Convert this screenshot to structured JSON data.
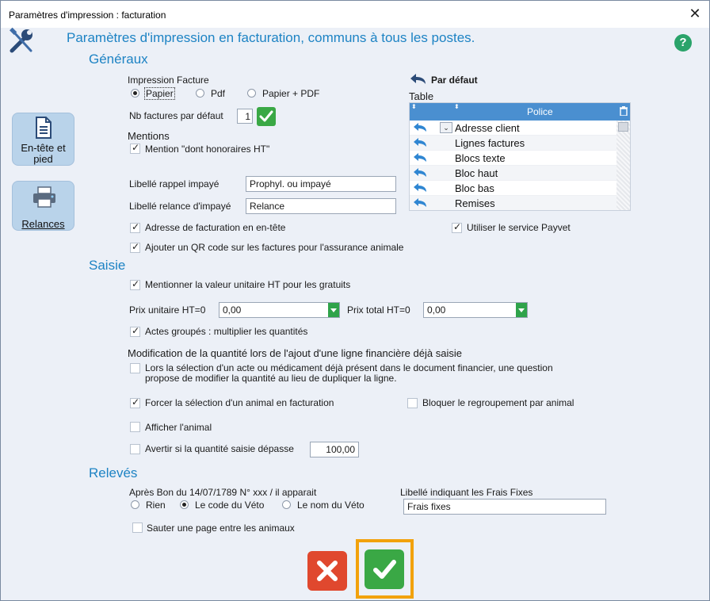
{
  "window": {
    "title": "Paramètres  d'impression : facturation",
    "close_glyph": "✕"
  },
  "header": {
    "title": "Paramètres d'impression en facturation, communs à tous les  postes.",
    "help_glyph": "?"
  },
  "sidebar": {
    "items": [
      {
        "label_line1": "En-tête et",
        "label_line2": "pied",
        "icon": "document-icon"
      },
      {
        "label": "Relances",
        "icon": "printer-icon"
      }
    ]
  },
  "generaux": {
    "section_label": "Généraux",
    "impression": {
      "label": "Impression Facture",
      "options": [
        "Papier",
        "Pdf",
        "Papier + PDF"
      ],
      "selected": "Papier"
    },
    "nb_factures": {
      "label": "Nb factures par défaut",
      "value": "1"
    },
    "mentions": {
      "label": "Mentions",
      "honoraires": {
        "label": "Mention \"dont honoraires HT\"",
        "checked": true
      }
    },
    "libelle_rappel": {
      "label": "Libellé rappel impayé",
      "value": "Prophyl. ou impayé"
    },
    "libelle_relance": {
      "label": "Libellé relance d'impayé",
      "value": "Relance"
    },
    "adresse_entete": {
      "label": "Adresse de facturation en en-tête",
      "checked": true
    },
    "payvet": {
      "label": "Utiliser le service Payvet",
      "checked": true
    },
    "qr_code": {
      "label": "Ajouter un QR code sur les factures pour l'assurance animale",
      "checked": true
    },
    "par_defaut": {
      "label": "Par défaut"
    },
    "table": {
      "label": "Table",
      "column_header": "Police",
      "rows": [
        "Adresse client",
        "Lignes factures",
        "Blocs texte",
        "Bloc haut",
        "Bloc bas",
        "Remises"
      ]
    }
  },
  "saisie": {
    "section_label": "Saisie",
    "valeur_unitaire": {
      "label": "Mentionner la valeur unitaire HT pour les gratuits",
      "checked": true
    },
    "prix_unitaire": {
      "label": "Prix unitaire HT=0",
      "value": "0,00"
    },
    "prix_total": {
      "label": "Prix total HT=0",
      "value": "0,00"
    },
    "actes_groupes": {
      "label": "Actes groupés : multiplier les quantités",
      "checked": true
    },
    "modification": {
      "label": "Modification de la quantité lors de l'ajout d'une ligne financière déjà saisie",
      "text_line1": "Lors la sélection d'un acte ou médicament déjà présent dans le document financier, une question",
      "text_line2": "propose de modifier la quantité au lieu de dupliquer la ligne.",
      "checked": false
    },
    "forcer_animal": {
      "label": "Forcer la sélection d'un animal en facturation",
      "checked": true
    },
    "bloquer_regroupement": {
      "label": "Bloquer le regroupement par animal",
      "checked": false
    },
    "afficher_animal": {
      "label": "Afficher l'animal",
      "checked": false
    },
    "avertir_quantite": {
      "label": "Avertir si la quantité saisie dépasse",
      "checked": false,
      "value": "100,00"
    }
  },
  "releves": {
    "section_label": "Relevés",
    "apres_bon": {
      "label": "Après Bon du 14/07/1789 N° xxx /  il apparait",
      "options": [
        "Rien",
        "Le code du Véto",
        "Le nom du Véto"
      ],
      "selected": "Le code du Véto"
    },
    "frais_fixes": {
      "label": "Libellé indiquant les Frais Fixes",
      "value": "Frais fixes"
    },
    "sauter_page": {
      "label": "Sauter une page entre les animaux",
      "checked": false
    }
  },
  "footer": {
    "cancel_icon": "cross-icon",
    "ok_icon": "check-icon"
  },
  "colors": {
    "accent": "#1d83c4",
    "ok_green": "#3aa845",
    "cancel_red": "#e0482e",
    "focus_orange": "#f2a20c",
    "table_header": "#4a8fd0"
  }
}
